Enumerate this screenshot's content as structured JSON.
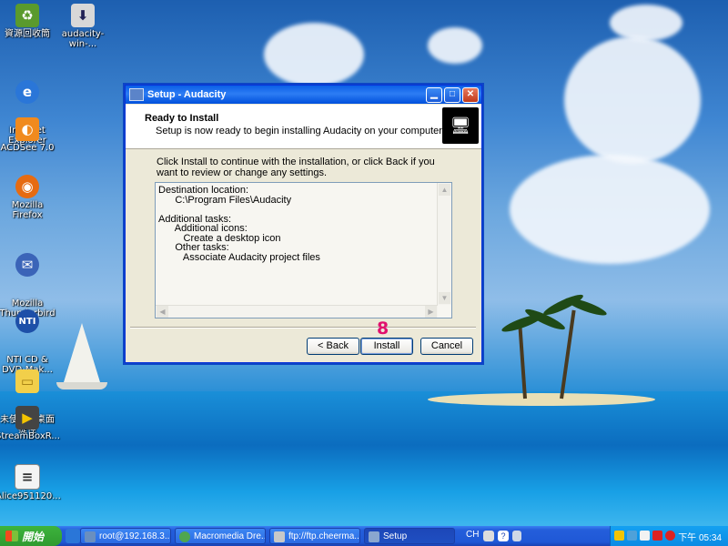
{
  "desktop": {
    "icons": [
      {
        "label": "資源回收筒"
      },
      {
        "label": "audacity-win-..."
      },
      {
        "label": "Internet\nExplorer"
      },
      {
        "label": "ACDSee 7.0"
      },
      {
        "label": "Mozilla Firefox"
      },
      {
        "label": "Mozilla\nThunderbird"
      },
      {
        "label": "NTI CD &\nDVD-Mak..."
      },
      {
        "label": "未使用的桌面\n捷徑"
      },
      {
        "label": "StreamBoxR..."
      },
      {
        "label": "Alice951120..."
      }
    ]
  },
  "dialog": {
    "title": "Setup - Audacity",
    "header_title": "Ready to Install",
    "header_subtitle": "Setup is now ready to begin installing Audacity on your computer.",
    "intro": "Click Install to continue with the installation, or click Back if you want to review or change any settings.",
    "memo": "Destination location:\n      C:\\Program Files\\Audacity\n\nAdditional tasks:\n      Additional icons:\n         Create a desktop icon\n      Other tasks:\n         Associate Audacity project files",
    "back_label": "< Back",
    "install_label": "Install",
    "cancel_label": "Cancel",
    "step_marker": "8"
  },
  "taskbar": {
    "start_label": "開始",
    "tasks": [
      {
        "label": "root@192.168.3..."
      },
      {
        "label": "Macromedia Dre..."
      },
      {
        "label": "ftp://ftp.cheerma..."
      },
      {
        "label": "Setup"
      }
    ],
    "language": "CH",
    "clock": "下午 05:34"
  }
}
